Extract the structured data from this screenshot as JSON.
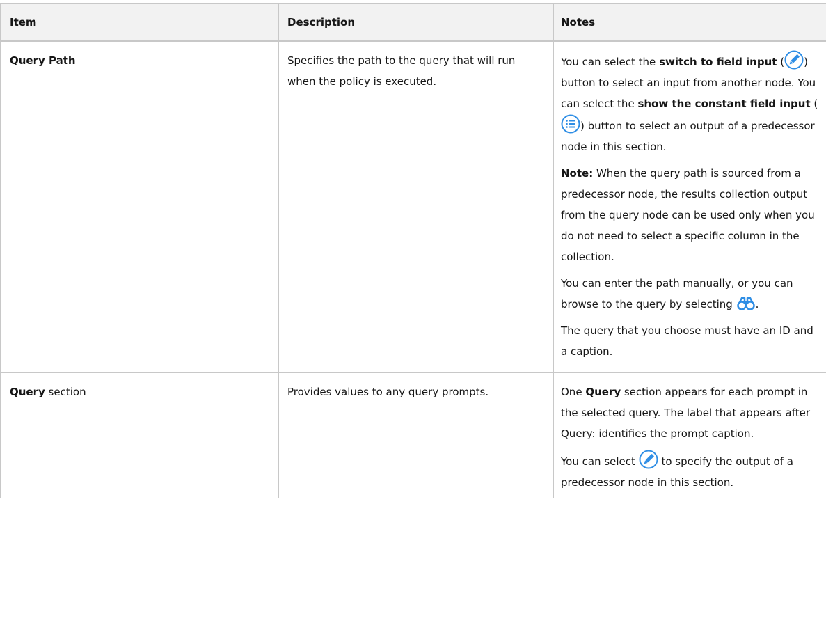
{
  "table": {
    "headers": [
      "Item",
      "Description",
      "Notes"
    ],
    "row1": {
      "item": "Query Path",
      "description": "Specifies the path to the query that will run when the policy is executed.",
      "notes": {
        "p1_a": "You can select the ",
        "p1_b": "switch to field input",
        "p1_c": " (",
        "p1_d": ") button to select an input from another node. You can select the ",
        "p1_e": "show the constant field input",
        "p1_f": " (",
        "p1_g": ") button to select an output of a predecessor node in this section.",
        "p2_label": "Note:",
        "p2_text": " When the query path is sourced from a predecessor node, the results collection output from the query node can be used only when you do not need to select a specific column in the collection.",
        "p3_a": "You can enter the path manually, or you can browse to the query by selecting ",
        "p3_b": ".",
        "p4": "The query that you choose must have an ID and a caption."
      }
    },
    "row2": {
      "item_bold": "Query",
      "item_rest": " section",
      "description": "Provides values to any query prompts.",
      "notes": {
        "p1_a": "One ",
        "p1_b": "Query",
        "p1_c": " section appears for each prompt in the selected query. The label that appears after Query: identifies the prompt caption.",
        "p2_a": "You can select ",
        "p2_b": " to specify the output of a predecessor node in this section."
      }
    }
  },
  "icons": {
    "pencil": "pencil-icon",
    "list": "list-icon",
    "binoculars": "binoculars-icon",
    "accent": "#2f8ee5"
  }
}
